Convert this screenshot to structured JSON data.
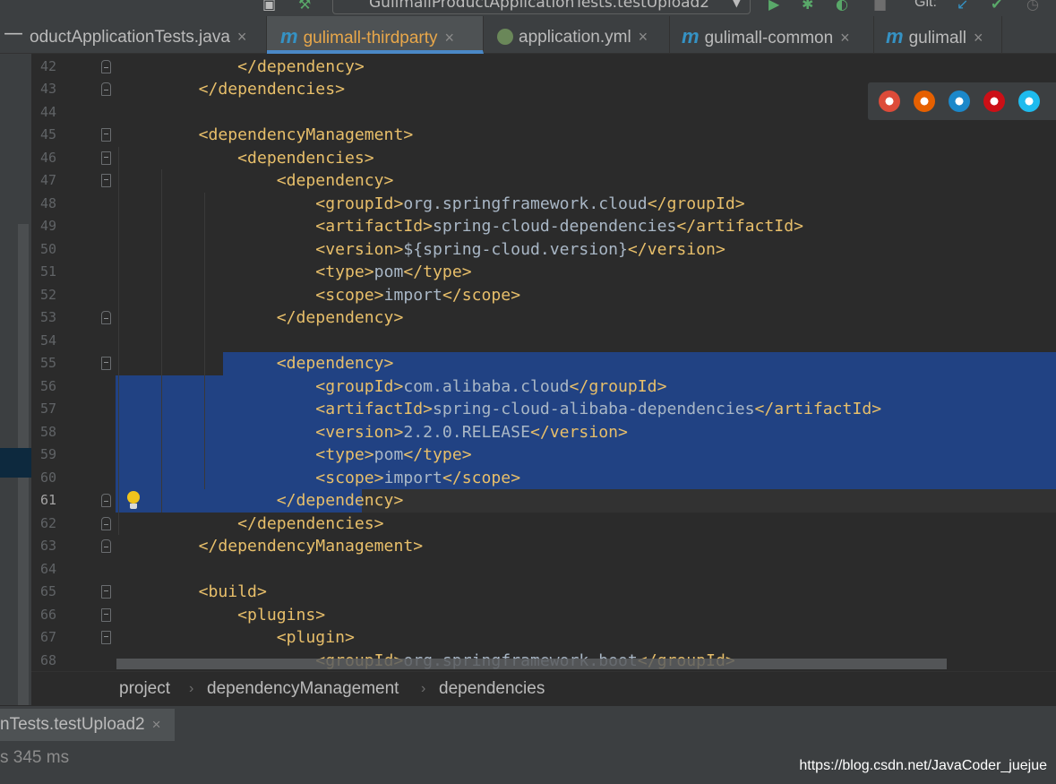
{
  "toolbar": {
    "run_config": "GulimallProductApplicationTests.testUpload2",
    "git_label": "Git:"
  },
  "tabs": [
    {
      "label": "oductApplicationTests.java",
      "type": "java"
    },
    {
      "label": "gulimall-thirdparty",
      "type": "maven",
      "active": true
    },
    {
      "label": "application.yml",
      "type": "spring"
    },
    {
      "label": "gulimall-common",
      "type": "maven"
    },
    {
      "label": "gulimall",
      "type": "maven"
    }
  ],
  "editor": {
    "current_line": 61,
    "lines": [
      {
        "n": "42",
        "indent": "        ",
        "content": [
          [
            "tag",
            "</dependency>"
          ]
        ]
      },
      {
        "n": "43",
        "indent": "    ",
        "content": [
          [
            "tag",
            "</dependencies>"
          ]
        ]
      },
      {
        "n": "44",
        "indent": "",
        "content": []
      },
      {
        "n": "45",
        "indent": "    ",
        "content": [
          [
            "tag",
            "<dependencyManagement>"
          ]
        ]
      },
      {
        "n": "46",
        "indent": "        ",
        "content": [
          [
            "tag",
            "<dependencies>"
          ]
        ]
      },
      {
        "n": "47",
        "indent": "            ",
        "content": [
          [
            "tag",
            "<dependency>"
          ]
        ]
      },
      {
        "n": "48",
        "indent": "                ",
        "content": [
          [
            "tag",
            "<groupId>"
          ],
          [
            "txt",
            "org.springframework.cloud"
          ],
          [
            "tag",
            "</groupId>"
          ]
        ]
      },
      {
        "n": "49",
        "indent": "                ",
        "content": [
          [
            "tag",
            "<artifactId>"
          ],
          [
            "txt",
            "spring-cloud-dependencies"
          ],
          [
            "tag",
            "</artifactId>"
          ]
        ]
      },
      {
        "n": "50",
        "indent": "                ",
        "content": [
          [
            "tag",
            "<version>"
          ],
          [
            "txt",
            "${spring-cloud.version}"
          ],
          [
            "tag",
            "</version>"
          ]
        ]
      },
      {
        "n": "51",
        "indent": "                ",
        "content": [
          [
            "tag",
            "<type>"
          ],
          [
            "txt",
            "pom"
          ],
          [
            "tag",
            "</type>"
          ]
        ]
      },
      {
        "n": "52",
        "indent": "                ",
        "content": [
          [
            "tag",
            "<scope>"
          ],
          [
            "txt",
            "import"
          ],
          [
            "tag",
            "</scope>"
          ]
        ]
      },
      {
        "n": "53",
        "indent": "            ",
        "content": [
          [
            "tag",
            "</dependency>"
          ]
        ]
      },
      {
        "n": "54",
        "indent": "",
        "content": []
      },
      {
        "n": "55",
        "indent": "            ",
        "content": [
          [
            "tag",
            "<dependency>"
          ]
        ]
      },
      {
        "n": "56",
        "indent": "                ",
        "content": [
          [
            "tag",
            "<groupId>"
          ],
          [
            "txt",
            "com.alibaba.cloud"
          ],
          [
            "tag",
            "</groupId>"
          ]
        ]
      },
      {
        "n": "57",
        "indent": "                ",
        "content": [
          [
            "tag",
            "<artifactId>"
          ],
          [
            "txt",
            "spring-cloud-alibaba-dependencies"
          ],
          [
            "tag",
            "</artifactId>"
          ]
        ]
      },
      {
        "n": "58",
        "indent": "                ",
        "content": [
          [
            "tag",
            "<version>"
          ],
          [
            "txt",
            "2.2.0.RELEASE"
          ],
          [
            "tag",
            "</version>"
          ]
        ]
      },
      {
        "n": "59",
        "indent": "                ",
        "content": [
          [
            "tag",
            "<type>"
          ],
          [
            "txt",
            "pom"
          ],
          [
            "tag",
            "</type>"
          ]
        ]
      },
      {
        "n": "60",
        "indent": "                ",
        "content": [
          [
            "tag",
            "<scope>"
          ],
          [
            "txt",
            "import"
          ],
          [
            "tag",
            "</scope>"
          ]
        ]
      },
      {
        "n": "61",
        "indent": "            ",
        "content": [
          [
            "tag",
            "</dependency>"
          ]
        ]
      },
      {
        "n": "62",
        "indent": "        ",
        "content": [
          [
            "tag",
            "</dependencies>"
          ]
        ]
      },
      {
        "n": "63",
        "indent": "    ",
        "content": [
          [
            "tag",
            "</dependencyManagement>"
          ]
        ]
      },
      {
        "n": "64",
        "indent": "",
        "content": []
      },
      {
        "n": "65",
        "indent": "    ",
        "content": [
          [
            "tag",
            "<build>"
          ]
        ]
      },
      {
        "n": "66",
        "indent": "        ",
        "content": [
          [
            "tag",
            "<plugins>"
          ]
        ]
      },
      {
        "n": "67",
        "indent": "            ",
        "content": [
          [
            "tag",
            "<plugin>"
          ]
        ]
      },
      {
        "n": "68",
        "indent": "                ",
        "content": [
          [
            "tag",
            "<groupId>"
          ],
          [
            "txt",
            "org.springframework.boot"
          ],
          [
            "tag",
            "</groupId>"
          ]
        ]
      }
    ]
  },
  "browsers": [
    {
      "name": "chrome-icon",
      "color": "#dd4b39"
    },
    {
      "name": "firefox-icon",
      "color": "#e66000"
    },
    {
      "name": "safari-icon",
      "color": "#1b88ca"
    },
    {
      "name": "opera-icon",
      "color": "#cc0f16"
    },
    {
      "name": "ie-icon",
      "color": "#1ebbee"
    }
  ],
  "breadcrumb": [
    "project",
    "dependencyManagement",
    "dependencies"
  ],
  "run_panel": {
    "tab_label": "nTests.testUpload2",
    "elapsed": "s 345 ms"
  },
  "watermark": "https://blog.csdn.net/JavaCoder_juejue",
  "colors": {
    "background": "#2b2b2b",
    "tag": "#e8bf6a",
    "text": "#a9b7c6",
    "selection": "#214283",
    "accent": "#4a88c7"
  }
}
